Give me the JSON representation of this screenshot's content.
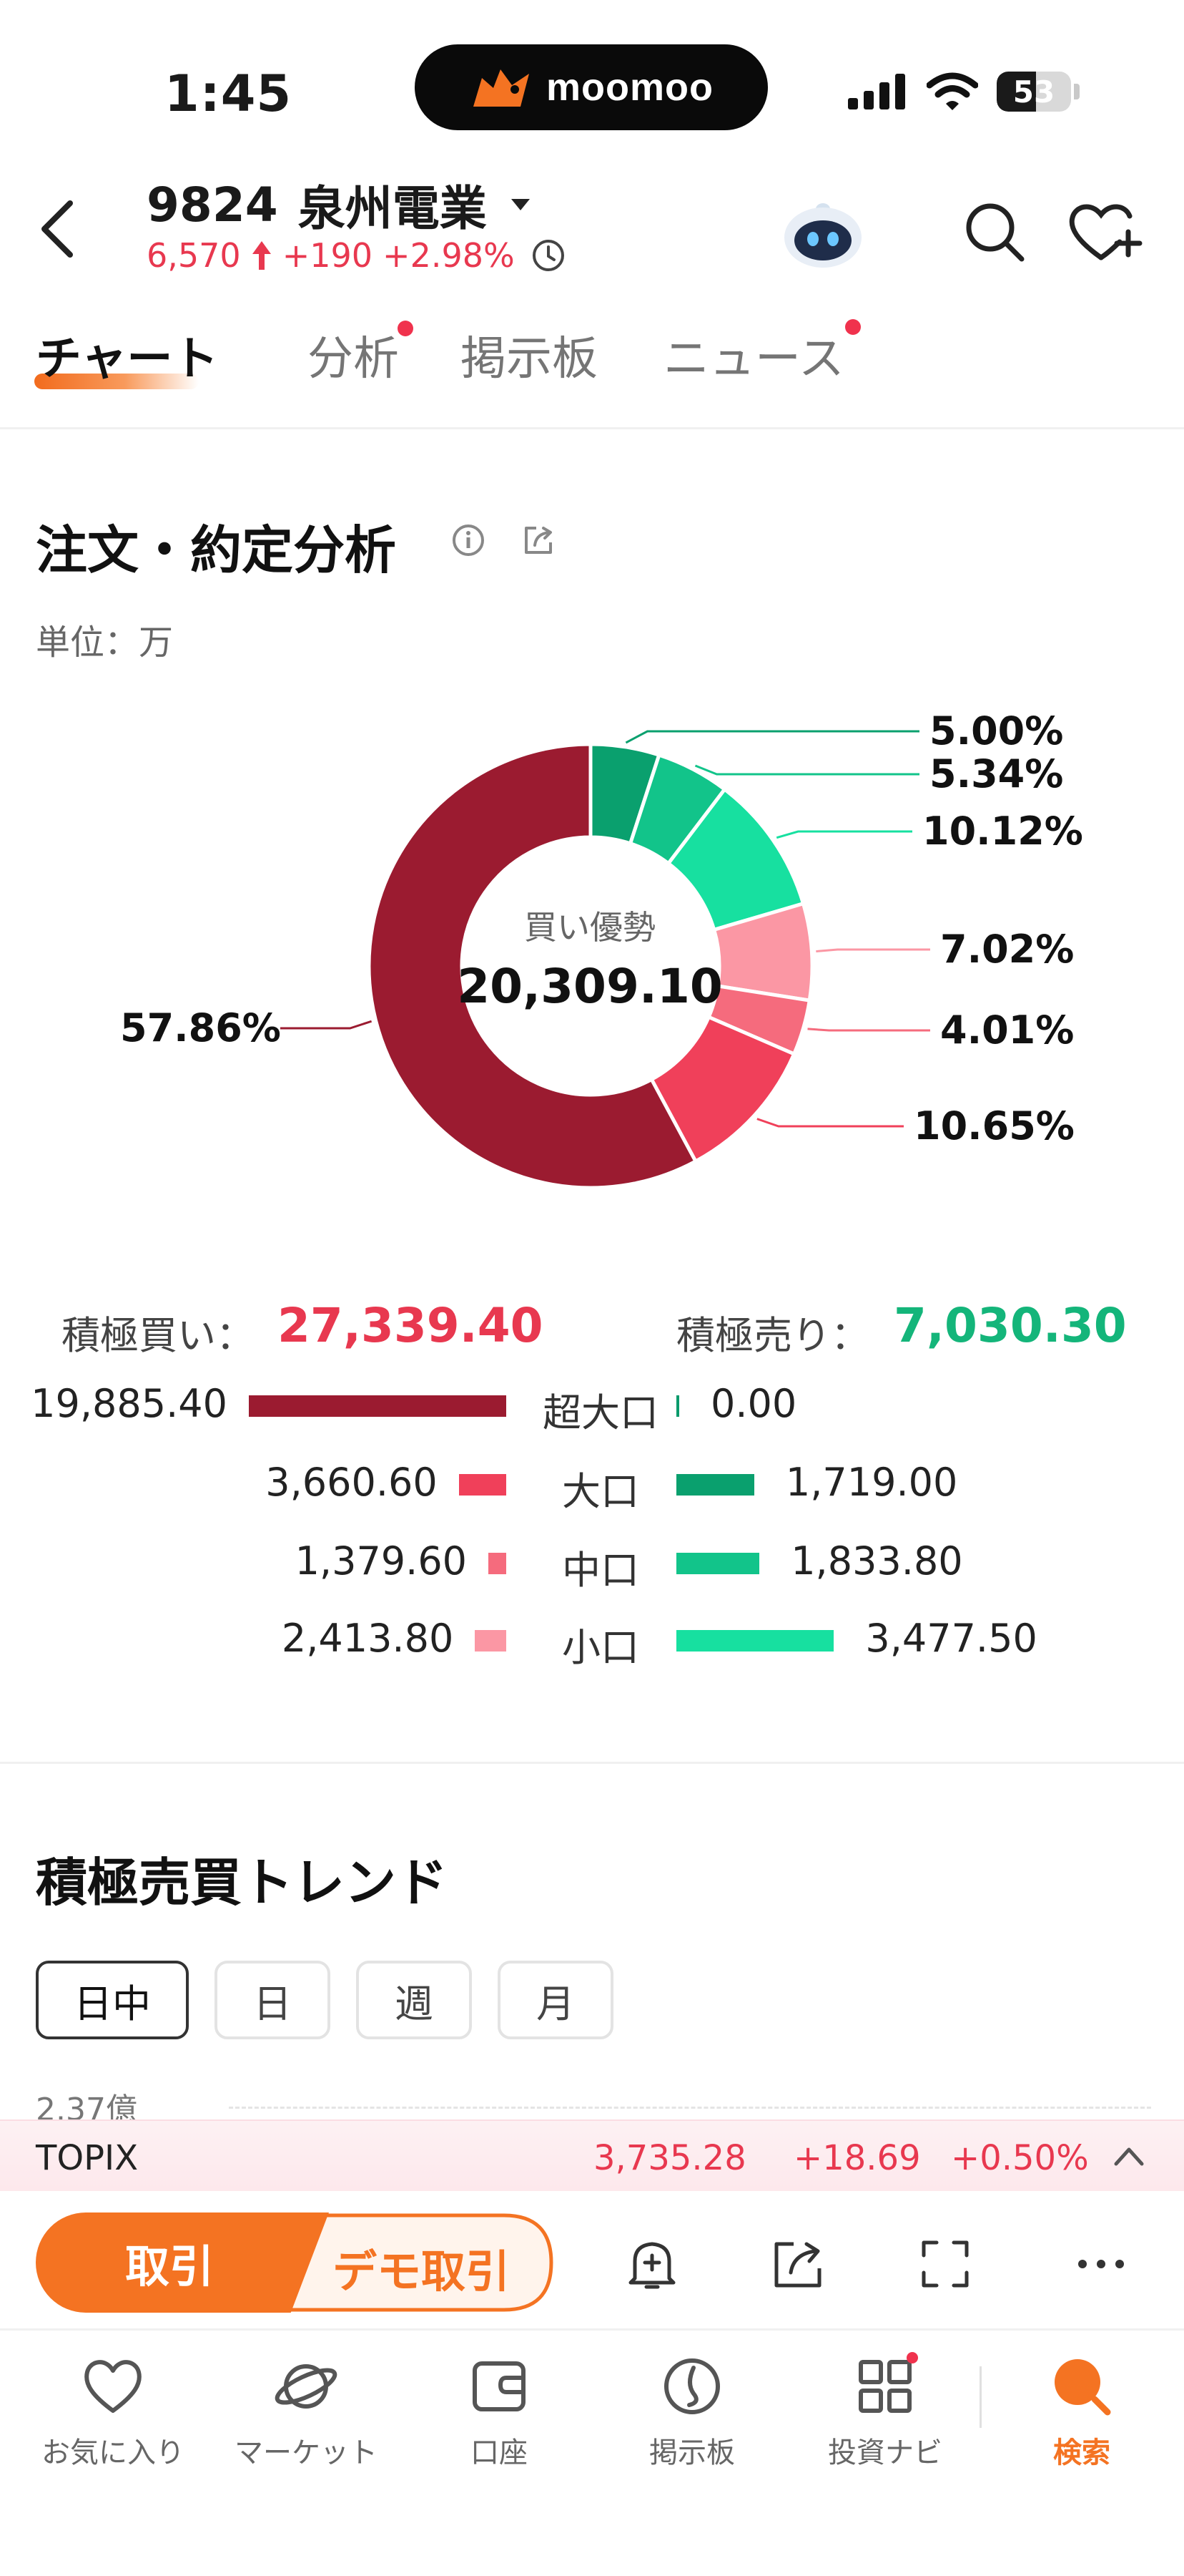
{
  "status_bar": {
    "time": "1:45",
    "brand": "moomoo",
    "battery": "53",
    "battery_level": 0.53
  },
  "header": {
    "code": "9824",
    "name": "泉州電業",
    "price": "6,570",
    "change": "+190",
    "change_pct": "+2.98%"
  },
  "tabs": [
    {
      "label": "チャート",
      "active": true,
      "dot": false
    },
    {
      "label": "分析",
      "active": false,
      "dot": true
    },
    {
      "label": "掲示板",
      "active": false,
      "dot": false
    },
    {
      "label": "ニュース",
      "active": false,
      "dot": true
    }
  ],
  "order_analysis": {
    "title": "注文・約定分析",
    "unit": "単位：万",
    "center_label": "買い優勢",
    "center_value": "20,309.10",
    "buy_label": "積極買い：",
    "buy_total": "27,339.40",
    "sell_label": "積極売り：",
    "sell_total": "7,030.30",
    "breakdown": [
      {
        "category": "超大口",
        "buy": "19,885.40",
        "sell": "0.00",
        "buy_num": 19885.4,
        "sell_num": 0.0,
        "buy_color": "#9b1b30",
        "sell_color": "#0a9b6c"
      },
      {
        "category": "大口",
        "buy": "3,660.60",
        "sell": "1,719.00",
        "buy_num": 3660.6,
        "sell_num": 1719.0,
        "buy_color": "#f0405a",
        "sell_color": "#0aa06e"
      },
      {
        "category": "中口",
        "buy": "1,379.60",
        "sell": "1,833.80",
        "buy_num": 1379.6,
        "sell_num": 1833.8,
        "buy_color": "#f56b7d",
        "sell_color": "#12c48a"
      },
      {
        "category": "小口",
        "buy": "2,413.80",
        "sell": "3,477.50",
        "buy_num": 2413.8,
        "sell_num": 3477.5,
        "buy_color": "#fb97a4",
        "sell_color": "#17e0a0"
      }
    ]
  },
  "chart_data": {
    "type": "pie",
    "title": "注文・約定分析",
    "categories": [
      "売り超大口",
      "売り大口",
      "売り中口",
      "売り小口",
      "買い小口",
      "買い中口",
      "買い大口",
      "買い超大口"
    ],
    "values": [
      0.0,
      5.0,
      5.34,
      10.12,
      7.02,
      4.01,
      10.65,
      57.86
    ],
    "labels": [
      "",
      "5.00%",
      "5.34%",
      "10.12%",
      "7.02%",
      "4.01%",
      "10.65%",
      "57.86%"
    ],
    "colors": [
      "#0a9b6c",
      "#0aa06e",
      "#12c48a",
      "#17e0a0",
      "#fb97a4",
      "#f56b7d",
      "#f0405a",
      "#9b1b30"
    ]
  },
  "trend": {
    "title": "積極売買トレンド",
    "periods": [
      "日中",
      "日",
      "週",
      "月"
    ],
    "active_period": 0,
    "y_label": "2.37億"
  },
  "ticker": {
    "name": "TOPIX",
    "value": "3,735.28",
    "change": "+18.69",
    "change_pct": "+0.50%"
  },
  "actions": {
    "trade": "取引",
    "demo_trade": "デモ取引"
  },
  "bottom_nav": [
    {
      "label": "お気に入り",
      "icon": "heart-icon"
    },
    {
      "label": "マーケット",
      "icon": "planet-icon"
    },
    {
      "label": "口座",
      "icon": "wallet-icon"
    },
    {
      "label": "掲示板",
      "icon": "board-icon"
    },
    {
      "label": "投資ナビ",
      "icon": "grid-icon"
    },
    {
      "label": "検索",
      "icon": "search-icon"
    }
  ]
}
